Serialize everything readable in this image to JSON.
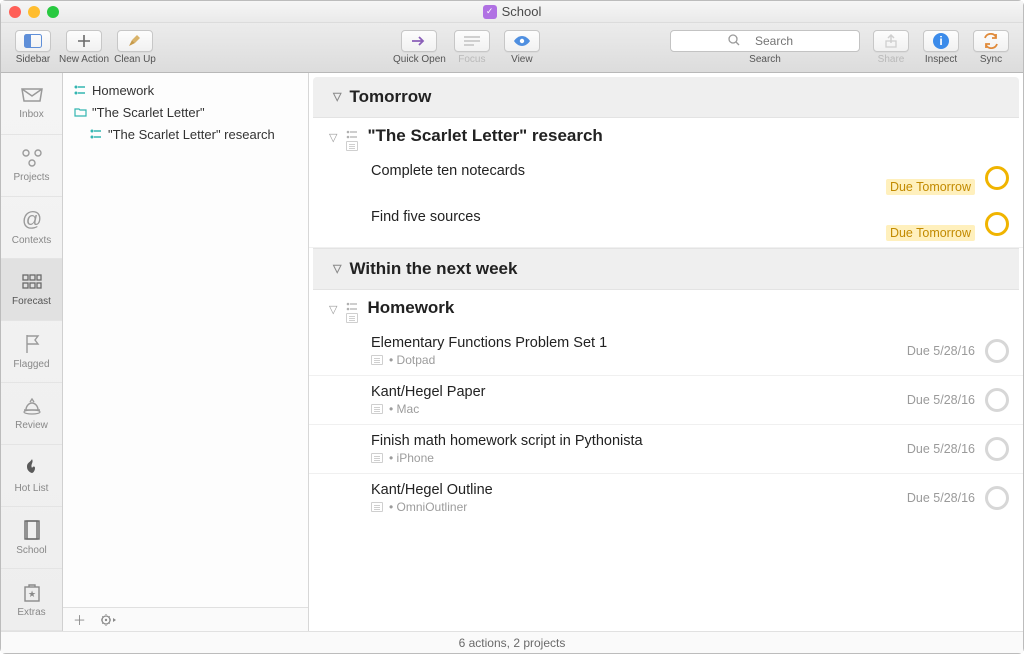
{
  "window": {
    "title": "School"
  },
  "toolbar": {
    "sidebar": "Sidebar",
    "new_action": "New Action",
    "clean_up": "Clean Up",
    "quick_open": "Quick Open",
    "focus": "Focus",
    "view": "View",
    "search_label": "Search",
    "search_placeholder": "Search",
    "share": "Share",
    "inspect": "Inspect",
    "sync": "Sync"
  },
  "perspectives": [
    {
      "label": "Inbox"
    },
    {
      "label": "Projects"
    },
    {
      "label": "Contexts"
    },
    {
      "label": "Forecast"
    },
    {
      "label": "Flagged"
    },
    {
      "label": "Review"
    },
    {
      "label": "Hot List"
    },
    {
      "label": "School"
    },
    {
      "label": "Extras"
    }
  ],
  "outline": {
    "items": [
      {
        "label": "Homework"
      },
      {
        "label": "\"The Scarlet Letter\""
      },
      {
        "label": "\"The Scarlet Letter\" research"
      }
    ]
  },
  "content": {
    "sections": [
      {
        "title": "Tomorrow",
        "projects": [
          {
            "title": "\"The Scarlet Letter\" research",
            "tasks": [
              {
                "title": "Complete ten notecards",
                "due": "Due Tomorrow",
                "hot": true
              },
              {
                "title": "Find five sources",
                "due": "Due Tomorrow",
                "hot": true
              }
            ]
          }
        ]
      },
      {
        "title": "Within the next week",
        "projects": [
          {
            "title": "Homework",
            "tasks": [
              {
                "title": "Elementary Functions Problem Set 1",
                "context": "Dotpad",
                "due": "Due 5/28/16"
              },
              {
                "title": "Kant/Hegel Paper",
                "context": "Mac",
                "due": "Due 5/28/16"
              },
              {
                "title": "Finish math homework script in Pythonista",
                "context": "iPhone",
                "due": "Due 5/28/16"
              },
              {
                "title": "Kant/Hegel Outline",
                "context": "OmniOutliner",
                "due": "Due 5/28/16"
              }
            ]
          }
        ]
      }
    ]
  },
  "status": "6 actions, 2 projects"
}
